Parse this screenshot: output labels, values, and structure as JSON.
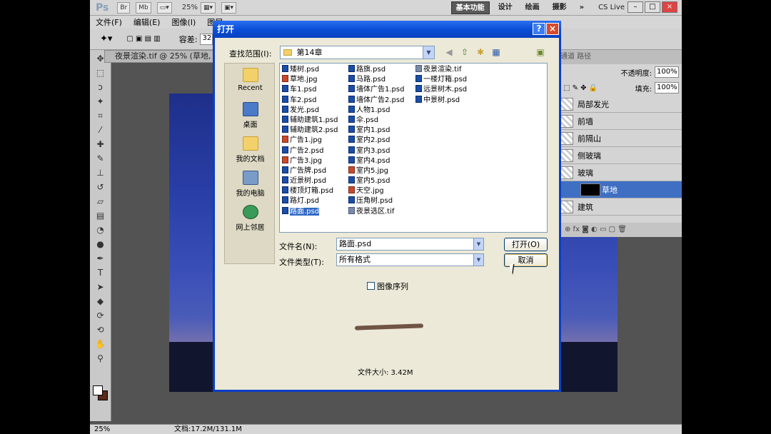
{
  "app": {
    "logo": "Ps",
    "btn_br": "Br",
    "btn_mb": "Mb",
    "zoom": "25%",
    "workspaces": [
      "基本功能",
      "设计",
      "绘画",
      "摄影"
    ],
    "more": "»",
    "cs_live": "CS Live"
  },
  "menu": [
    "文件(F)",
    "编辑(E)",
    "图像(I)",
    "图层"
  ],
  "options": {
    "tolerance_label": "容差:",
    "tolerance_value": "32"
  },
  "document": {
    "tab_title": "夜景渲染.tif @ 25% (草地,"
  },
  "status": {
    "zoom": "25%",
    "doc_size": "文档:17.2M/131.1M"
  },
  "layers_panel": {
    "tabs": "通道  路径",
    "opacity_label": "不透明度:",
    "opacity_value": "100%",
    "fill_label": "填充:",
    "fill_value": "100%",
    "layers": [
      {
        "name": "局部发光",
        "active": false
      },
      {
        "name": "前墙",
        "active": false
      },
      {
        "name": "前隔山",
        "active": false
      },
      {
        "name": "侧玻璃",
        "active": false
      },
      {
        "name": "玻璃",
        "active": false
      },
      {
        "name": "草地",
        "active": true
      },
      {
        "name": "建筑",
        "active": false
      }
    ]
  },
  "dialog": {
    "title": "打开",
    "help": "?",
    "close": "×",
    "look_in_label": "查找范围(I):",
    "look_in_value": "第14章",
    "places": [
      "Recent",
      "桌面",
      "我的文档",
      "我的电脑",
      "网上邻居"
    ],
    "files_col1": [
      {
        "name": "矮树.psd",
        "type": "psd"
      },
      {
        "name": "草地.jpg",
        "type": "jpg"
      },
      {
        "name": "车1.psd",
        "type": "psd"
      },
      {
        "name": "车2.psd",
        "type": "psd"
      },
      {
        "name": "发光.psd",
        "type": "psd"
      },
      {
        "name": "辅助建筑1.psd",
        "type": "psd"
      },
      {
        "name": "辅助建筑2.psd",
        "type": "psd"
      },
      {
        "name": "广告1.jpg",
        "type": "jpg"
      },
      {
        "name": "广告2.psd",
        "type": "psd"
      },
      {
        "name": "广告3.jpg",
        "type": "jpg"
      },
      {
        "name": "广告牌.psd",
        "type": "psd"
      },
      {
        "name": "近景树.psd",
        "type": "psd"
      },
      {
        "name": "楼顶灯箱.psd",
        "type": "psd"
      },
      {
        "name": "路灯.psd",
        "type": "psd"
      },
      {
        "name": "路面.psd",
        "type": "psd",
        "selected": true
      }
    ],
    "files_col2": [
      {
        "name": "路旗.psd",
        "type": "psd"
      },
      {
        "name": "马路.psd",
        "type": "psd"
      },
      {
        "name": "墙体广告1.psd",
        "type": "psd"
      },
      {
        "name": "墙体广告2.psd",
        "type": "psd"
      },
      {
        "name": "人物1.psd",
        "type": "psd"
      },
      {
        "name": "伞.psd",
        "type": "psd"
      },
      {
        "name": "室内1.psd",
        "type": "psd"
      },
      {
        "name": "室内2.psd",
        "type": "psd"
      },
      {
        "name": "室内3.psd",
        "type": "psd"
      },
      {
        "name": "室内4.psd",
        "type": "psd"
      },
      {
        "name": "室内5.jpg",
        "type": "jpg"
      },
      {
        "name": "室内5.psd",
        "type": "psd"
      },
      {
        "name": "天空.jpg",
        "type": "jpg"
      },
      {
        "name": "压角树.psd",
        "type": "psd"
      },
      {
        "name": "夜景选区.tif",
        "type": "tif"
      }
    ],
    "files_col3": [
      {
        "name": "夜景渲染.tif",
        "type": "tif"
      },
      {
        "name": "一楼灯箱.psd",
        "type": "psd"
      },
      {
        "name": "远景树木.psd",
        "type": "psd"
      },
      {
        "name": "中景树.psd",
        "type": "psd"
      }
    ],
    "filename_label": "文件名(N):",
    "filename_value": "路面.psd",
    "filetype_label": "文件类型(T):",
    "filetype_value": "所有格式",
    "open_button": "打开(O)",
    "cancel_button": "取消",
    "image_sequence": "图像序列",
    "file_size": "文件大小: 3.42M"
  },
  "colors": {
    "title_bar": "#0a4fd8",
    "selection": "#316ac5",
    "active_layer": "#3f6fc3"
  }
}
